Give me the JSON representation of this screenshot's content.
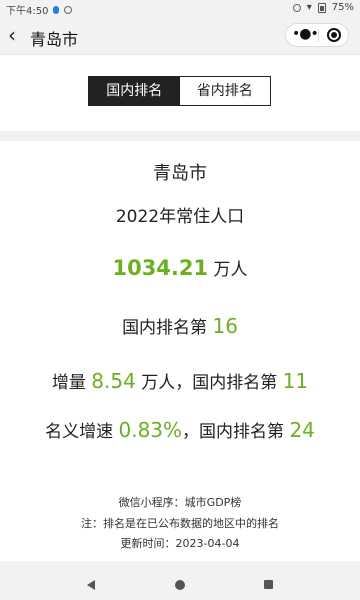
{
  "status_bar": {
    "time": "下午4:50",
    "battery": "75%"
  },
  "header": {
    "title": "青岛市"
  },
  "tabs": [
    {
      "label": "国内排名",
      "active": true
    },
    {
      "label": "省内排名",
      "active": false
    }
  ],
  "card": {
    "city": "青岛市",
    "metric": "2022年常住人口",
    "population_value": "1034.21",
    "population_unit": "万人",
    "rank_prefix": "国内排名第",
    "rank_value": "16",
    "increase_prefix": "增量",
    "increase_value": "8.54",
    "increase_mid": "万人，国内排名第",
    "increase_rank": "11",
    "growth_prefix": "名义增速",
    "growth_value": "0.83%",
    "growth_mid": "，国内排名第",
    "growth_rank": "24"
  },
  "footer": {
    "source": "微信小程序：城市GDP榜",
    "note": "注：排名是在已公布数据的地区中的排名",
    "updated": "更新时间：2023-04-04"
  },
  "colors": {
    "accent_green": "#6ab022",
    "tab_active_bg": "#222222",
    "page_bg": "#f2f2f2"
  },
  "icons": [
    "back-icon",
    "more-icon",
    "close-circle-icon",
    "nav-back-icon",
    "nav-home-icon",
    "nav-recent-icon"
  ]
}
